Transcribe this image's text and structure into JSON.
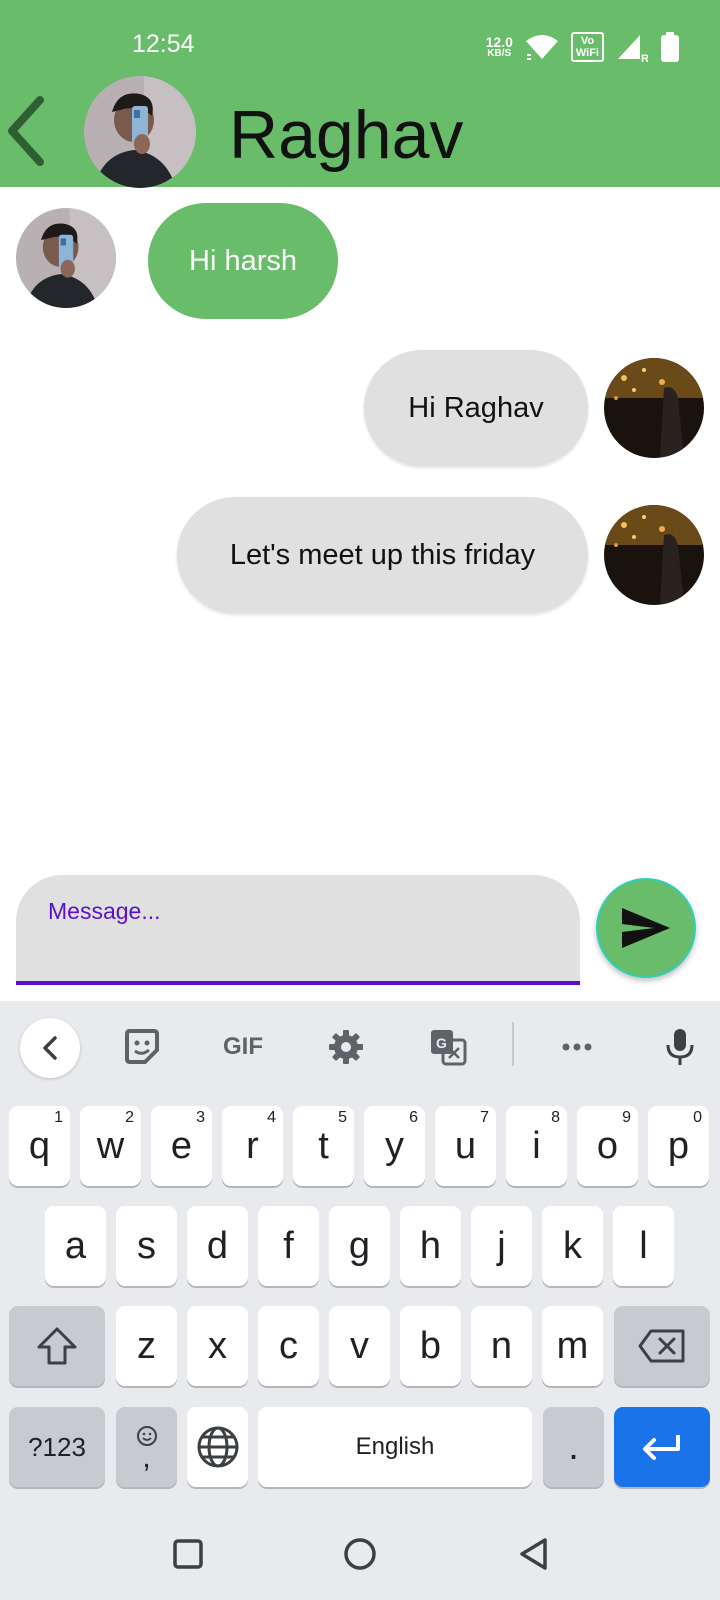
{
  "status_bar": {
    "time": "12:54",
    "net_speed_value": "12.0",
    "net_speed_unit": "KB/S",
    "vowifi_line1": "Vo",
    "vowifi_line2": "WiFi",
    "signal_badge": "R"
  },
  "header": {
    "contact_name": "Raghav"
  },
  "messages": [
    {
      "direction": "incoming",
      "text": "Hi harsh"
    },
    {
      "direction": "outgoing",
      "text": "Hi Raghav"
    },
    {
      "direction": "outgoing",
      "text": "Let's meet up this friday"
    }
  ],
  "composer": {
    "placeholder": "Message...",
    "value": ""
  },
  "keyboard": {
    "toolbar": {
      "gif_label": "GIF"
    },
    "row1": [
      {
        "key": "q",
        "hint": "1"
      },
      {
        "key": "w",
        "hint": "2"
      },
      {
        "key": "e",
        "hint": "3"
      },
      {
        "key": "r",
        "hint": "4"
      },
      {
        "key": "t",
        "hint": "5"
      },
      {
        "key": "y",
        "hint": "6"
      },
      {
        "key": "u",
        "hint": "7"
      },
      {
        "key": "i",
        "hint": "8"
      },
      {
        "key": "o",
        "hint": "9"
      },
      {
        "key": "p",
        "hint": "0"
      }
    ],
    "row2": [
      "a",
      "s",
      "d",
      "f",
      "g",
      "h",
      "j",
      "k",
      "l"
    ],
    "row3": [
      "z",
      "x",
      "c",
      "v",
      "b",
      "n",
      "m"
    ],
    "symbols_label": "?123",
    "emoji_comma_label": ",",
    "space_label": "English",
    "period_label": "."
  },
  "colors": {
    "accent_green": "#68bc6a",
    "input_accent": "#5b0fd0",
    "enter_blue": "#1a73e8"
  }
}
